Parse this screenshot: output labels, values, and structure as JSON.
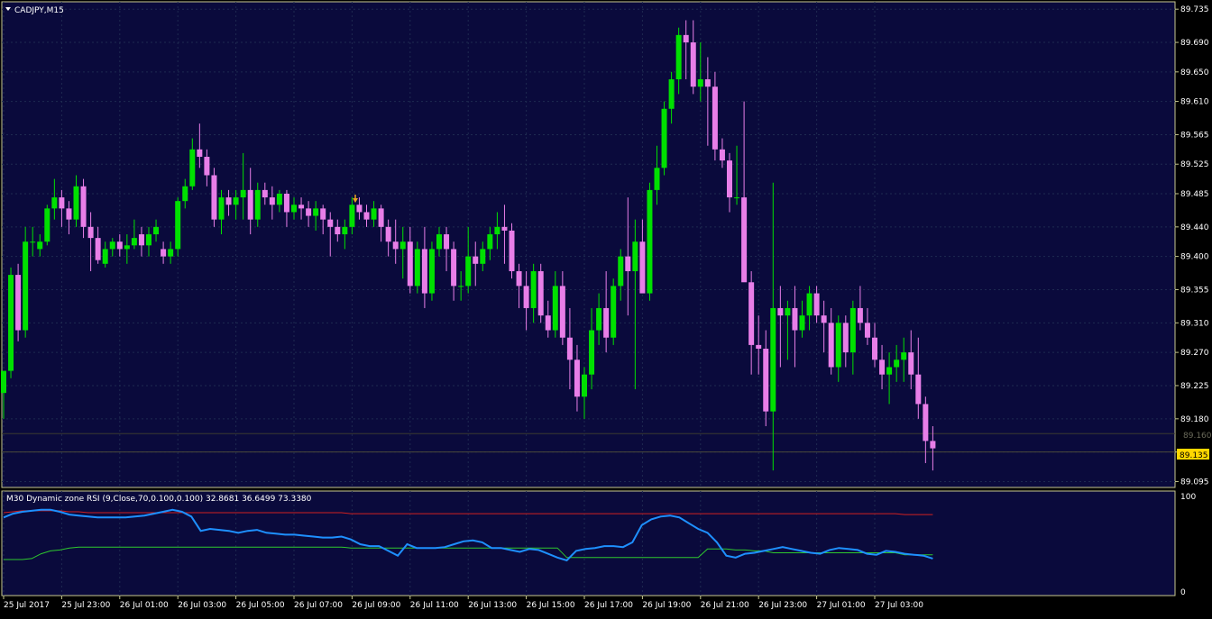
{
  "window": {
    "symbol_title": "CADJPY,M15",
    "indicator_title": "M30 Dynamic zone RSI (9,Close,70,0.100,0.100) 32.8681 36.6499 73.3380"
  },
  "colors": {
    "background": "#0a0a3c",
    "frame": "#c8c890",
    "grid": "#1e2a50",
    "bull": "#00e000",
    "bear": "#e87ee8",
    "text": "#ffffff",
    "price_tag": "#ffd700",
    "rsi": "#1e90ff",
    "upper_zone": "#d02020",
    "lower_zone": "#2ec82e",
    "arrow": "#e8a020"
  },
  "price_axis": {
    "labels": [
      "89.735",
      "89.690",
      "89.650",
      "89.610",
      "89.565",
      "89.525",
      "89.485",
      "89.440",
      "89.400",
      "89.355",
      "89.310",
      "89.270",
      "89.225",
      "89.180",
      "89.135",
      "89.095"
    ],
    "current_price": "89.135",
    "grid_price": "89.160",
    "range": [
      89.087,
      89.745
    ]
  },
  "indicator_axis": {
    "labels": [
      "100",
      "0"
    ],
    "range": [
      0,
      100
    ]
  },
  "time_axis": {
    "labels": [
      "25 Jul 2017",
      "25 Jul 23:00",
      "26 Jul 01:00",
      "26 Jul 03:00",
      "26 Jul 05:00",
      "26 Jul 07:00",
      "26 Jul 09:00",
      "26 Jul 11:00",
      "26 Jul 13:00",
      "26 Jul 15:00",
      "26 Jul 17:00",
      "26 Jul 19:00",
      "26 Jul 21:00",
      "26 Jul 23:00",
      "27 Jul 01:00",
      "27 Jul 03:00"
    ],
    "label_index": [
      0,
      8,
      16,
      24,
      32,
      40,
      48,
      56,
      64,
      72,
      80,
      88,
      96,
      104,
      112,
      120
    ]
  },
  "chart_data": {
    "type": "candlestick",
    "symbol": "CADJPY",
    "timeframe": "M15",
    "ohlc": [
      [
        89.215,
        89.245,
        89.18,
        89.245
      ],
      [
        89.245,
        89.385,
        89.235,
        89.375
      ],
      [
        89.375,
        89.39,
        89.285,
        89.3
      ],
      [
        89.3,
        89.44,
        89.29,
        89.42
      ],
      [
        89.42,
        89.44,
        89.4,
        89.42
      ],
      [
        89.41,
        89.43,
        89.4,
        89.42
      ],
      [
        89.42,
        89.47,
        89.415,
        89.465
      ],
      [
        89.465,
        89.505,
        89.45,
        89.48
      ],
      [
        89.48,
        89.49,
        89.44,
        89.465
      ],
      [
        89.465,
        89.475,
        89.43,
        89.45
      ],
      [
        89.45,
        89.51,
        89.44,
        89.495
      ],
      [
        89.495,
        89.505,
        89.425,
        89.44
      ],
      [
        89.44,
        89.46,
        89.38,
        89.425
      ],
      [
        89.425,
        89.44,
        89.39,
        89.395
      ],
      [
        89.39,
        89.42,
        89.385,
        89.41
      ],
      [
        89.41,
        89.425,
        89.4,
        89.42
      ],
      [
        89.42,
        89.43,
        89.4,
        89.41
      ],
      [
        89.41,
        89.43,
        89.39,
        89.415
      ],
      [
        89.415,
        89.45,
        89.41,
        89.425
      ],
      [
        89.43,
        89.44,
        89.4,
        89.415
      ],
      [
        89.415,
        89.44,
        89.4,
        89.43
      ],
      [
        89.43,
        89.45,
        89.42,
        89.44
      ],
      [
        89.41,
        89.42,
        89.39,
        89.4
      ],
      [
        89.4,
        89.42,
        89.39,
        89.41
      ],
      [
        89.41,
        89.48,
        89.4,
        89.475
      ],
      [
        89.475,
        89.505,
        89.465,
        89.495
      ],
      [
        89.495,
        89.56,
        89.49,
        89.545
      ],
      [
        89.545,
        89.58,
        89.52,
        89.535
      ],
      [
        89.535,
        89.545,
        89.495,
        89.51
      ],
      [
        89.51,
        89.52,
        89.44,
        89.45
      ],
      [
        89.45,
        89.49,
        89.43,
        89.48
      ],
      [
        89.48,
        89.49,
        89.455,
        89.47
      ],
      [
        89.47,
        89.49,
        89.45,
        89.48
      ],
      [
        89.48,
        89.54,
        89.45,
        89.49
      ],
      [
        89.49,
        89.52,
        89.43,
        89.45
      ],
      [
        89.45,
        89.5,
        89.44,
        89.49
      ],
      [
        89.49,
        89.5,
        89.47,
        89.48
      ],
      [
        89.48,
        89.495,
        89.45,
        89.47
      ],
      [
        89.47,
        89.49,
        89.46,
        89.485
      ],
      [
        89.485,
        89.49,
        89.44,
        89.46
      ],
      [
        89.46,
        89.48,
        89.45,
        89.47
      ],
      [
        89.47,
        89.48,
        89.45,
        89.465
      ],
      [
        89.465,
        89.475,
        89.44,
        89.455
      ],
      [
        89.455,
        89.475,
        89.435,
        89.465
      ],
      [
        89.465,
        89.47,
        89.43,
        89.45
      ],
      [
        89.45,
        89.46,
        89.4,
        89.44
      ],
      [
        89.44,
        89.45,
        89.42,
        89.43
      ],
      [
        89.43,
        89.45,
        89.41,
        89.44
      ],
      [
        89.44,
        89.48,
        89.43,
        89.47
      ],
      [
        89.47,
        89.48,
        89.45,
        89.46
      ],
      [
        89.46,
        89.47,
        89.44,
        89.45
      ],
      [
        89.45,
        89.475,
        89.44,
        89.465
      ],
      [
        89.465,
        89.47,
        89.42,
        89.44
      ],
      [
        89.44,
        89.45,
        89.4,
        89.42
      ],
      [
        89.42,
        89.45,
        89.39,
        89.41
      ],
      [
        89.41,
        89.44,
        89.37,
        89.42
      ],
      [
        89.42,
        89.44,
        89.35,
        89.36
      ],
      [
        89.36,
        89.42,
        89.35,
        89.41
      ],
      [
        89.41,
        89.44,
        89.33,
        89.35
      ],
      [
        89.35,
        89.42,
        89.34,
        89.41
      ],
      [
        89.41,
        89.44,
        89.4,
        89.43
      ],
      [
        89.43,
        89.44,
        89.38,
        89.41
      ],
      [
        89.41,
        89.42,
        89.34,
        89.36
      ],
      [
        89.36,
        89.38,
        89.34,
        89.36
      ],
      [
        89.36,
        89.44,
        89.35,
        89.4
      ],
      [
        89.4,
        89.42,
        89.36,
        89.39
      ],
      [
        89.39,
        89.42,
        89.38,
        89.41
      ],
      [
        89.41,
        89.44,
        89.395,
        89.43
      ],
      [
        89.43,
        89.46,
        89.41,
        89.44
      ],
      [
        89.44,
        89.47,
        89.39,
        89.435
      ],
      [
        89.435,
        89.445,
        89.37,
        89.38
      ],
      [
        89.38,
        89.39,
        89.33,
        89.36
      ],
      [
        89.36,
        89.38,
        89.3,
        89.33
      ],
      [
        89.33,
        89.39,
        89.31,
        89.38
      ],
      [
        89.38,
        89.39,
        89.31,
        89.32
      ],
      [
        89.32,
        89.34,
        89.29,
        89.3
      ],
      [
        89.3,
        89.38,
        89.29,
        89.36
      ],
      [
        89.36,
        89.38,
        89.28,
        89.29
      ],
      [
        89.29,
        89.33,
        89.22,
        89.26
      ],
      [
        89.26,
        89.28,
        89.19,
        89.21
      ],
      [
        89.21,
        89.25,
        89.18,
        89.24
      ],
      [
        89.24,
        89.33,
        89.22,
        89.3
      ],
      [
        89.3,
        89.35,
        89.28,
        89.33
      ],
      [
        89.33,
        89.38,
        89.27,
        89.29
      ],
      [
        89.29,
        89.37,
        89.28,
        89.36
      ],
      [
        89.36,
        89.41,
        89.34,
        89.4
      ],
      [
        89.4,
        89.48,
        89.32,
        89.38
      ],
      [
        89.38,
        89.45,
        89.22,
        89.42
      ],
      [
        89.42,
        89.45,
        89.36,
        89.35
      ],
      [
        89.35,
        89.5,
        89.34,
        89.49
      ],
      [
        89.49,
        89.55,
        89.47,
        89.52
      ],
      [
        89.52,
        89.61,
        89.51,
        89.6
      ],
      [
        89.6,
        89.65,
        89.58,
        89.64
      ],
      [
        89.64,
        89.71,
        89.62,
        89.7
      ],
      [
        89.7,
        89.72,
        89.64,
        89.69
      ],
      [
        89.69,
        89.72,
        89.62,
        89.63
      ],
      [
        89.63,
        89.69,
        89.61,
        89.64
      ],
      [
        89.64,
        89.67,
        89.55,
        89.63
      ],
      [
        89.63,
        89.65,
        89.53,
        89.545
      ],
      [
        89.545,
        89.56,
        89.52,
        89.53
      ],
      [
        89.53,
        89.54,
        89.46,
        89.48
      ],
      [
        89.48,
        89.55,
        89.47,
        89.48
      ],
      [
        89.48,
        89.61,
        89.47,
        89.365
      ],
      [
        89.365,
        89.38,
        89.24,
        89.28
      ],
      [
        89.28,
        89.32,
        89.24,
        89.275
      ],
      [
        89.275,
        89.3,
        89.17,
        89.19
      ],
      [
        89.19,
        89.5,
        89.11,
        89.33
      ],
      [
        89.33,
        89.36,
        89.25,
        89.32
      ],
      [
        89.32,
        89.34,
        89.26,
        89.33
      ],
      [
        89.33,
        89.36,
        89.25,
        89.3
      ],
      [
        89.3,
        89.34,
        89.29,
        89.32
      ],
      [
        89.32,
        89.36,
        89.3,
        89.35
      ],
      [
        89.35,
        89.36,
        89.31,
        89.32
      ],
      [
        89.32,
        89.34,
        89.27,
        89.31
      ],
      [
        89.31,
        89.33,
        89.24,
        89.25
      ],
      [
        89.25,
        89.32,
        89.23,
        89.31
      ],
      [
        89.31,
        89.32,
        89.25,
        89.27
      ],
      [
        89.27,
        89.34,
        89.24,
        89.33
      ],
      [
        89.33,
        89.36,
        89.3,
        89.31
      ],
      [
        89.31,
        89.33,
        89.28,
        89.29
      ],
      [
        89.29,
        89.31,
        89.25,
        89.26
      ],
      [
        89.26,
        89.28,
        89.22,
        89.24
      ],
      [
        89.24,
        89.27,
        89.2,
        89.25
      ],
      [
        89.25,
        89.28,
        89.23,
        89.26
      ],
      [
        89.26,
        89.29,
        89.23,
        89.27
      ],
      [
        89.27,
        89.3,
        89.22,
        89.24
      ],
      [
        89.24,
        89.29,
        89.18,
        89.2
      ],
      [
        89.2,
        89.21,
        89.12,
        89.15
      ],
      [
        89.15,
        89.17,
        89.11,
        89.14
      ]
    ],
    "rsi": [
      78,
      82,
      84,
      85,
      86,
      86,
      84,
      81,
      80,
      79,
      78,
      78,
      78,
      78,
      79,
      80,
      82,
      84,
      86,
      84,
      79,
      64,
      66,
      65,
      64,
      62,
      64,
      65,
      62,
      61,
      60,
      60,
      59,
      58,
      57,
      57,
      58,
      55,
      50,
      48,
      48,
      43,
      38,
      50,
      46,
      46,
      46,
      47,
      50,
      53,
      54,
      52,
      46,
      46,
      44,
      42,
      45,
      44,
      40,
      36,
      33,
      43,
      45,
      46,
      48,
      48,
      47,
      52,
      70,
      76,
      79,
      80,
      78,
      72,
      66,
      62,
      52,
      38,
      36,
      40,
      41,
      43,
      45,
      47,
      45,
      43,
      41,
      40,
      44,
      46,
      45,
      44,
      40,
      39,
      43,
      42,
      40,
      39,
      38,
      35
    ],
    "upper_zone": [
      83,
      84,
      85,
      85,
      85,
      85,
      85,
      84,
      84,
      83,
      83,
      83,
      83,
      83,
      83,
      83,
      83,
      83,
      83,
      83,
      83,
      83,
      83,
      83,
      83,
      83,
      83,
      83,
      83,
      83,
      83,
      83,
      83,
      83,
      83,
      83,
      83,
      82,
      82,
      82,
      82,
      82,
      82,
      82,
      82,
      82,
      82,
      82,
      82,
      82,
      82,
      82,
      82,
      82,
      82,
      82,
      82,
      82,
      82,
      82,
      82,
      82,
      82,
      82,
      82,
      82,
      82,
      82,
      82,
      82,
      82,
      82,
      82,
      82,
      82,
      82,
      82,
      82,
      82,
      82,
      82,
      82,
      82,
      82,
      82,
      82,
      82,
      82,
      82,
      82,
      82,
      82,
      82,
      82,
      82,
      82,
      81,
      81,
      81,
      81
    ],
    "lower_zone": [
      34,
      34,
      34,
      35,
      40,
      43,
      44,
      46,
      47,
      47,
      47,
      47,
      47,
      47,
      47,
      47,
      47,
      47,
      47,
      47,
      47,
      47,
      47,
      47,
      47,
      47,
      47,
      47,
      47,
      47,
      47,
      47,
      47,
      47,
      47,
      47,
      47,
      46,
      46,
      46,
      46,
      46,
      46,
      46,
      46,
      46,
      46,
      46,
      46,
      46,
      46,
      46,
      46,
      46,
      46,
      46,
      46,
      46,
      46,
      46,
      36,
      36,
      36,
      36,
      36,
      36,
      36,
      36,
      36,
      36,
      36,
      36,
      36,
      36,
      36,
      45,
      45,
      45,
      44,
      44,
      43,
      43,
      41,
      41,
      41,
      41,
      41,
      41,
      41,
      41,
      41,
      41,
      41,
      41,
      41,
      41,
      39,
      39,
      39,
      39
    ]
  }
}
